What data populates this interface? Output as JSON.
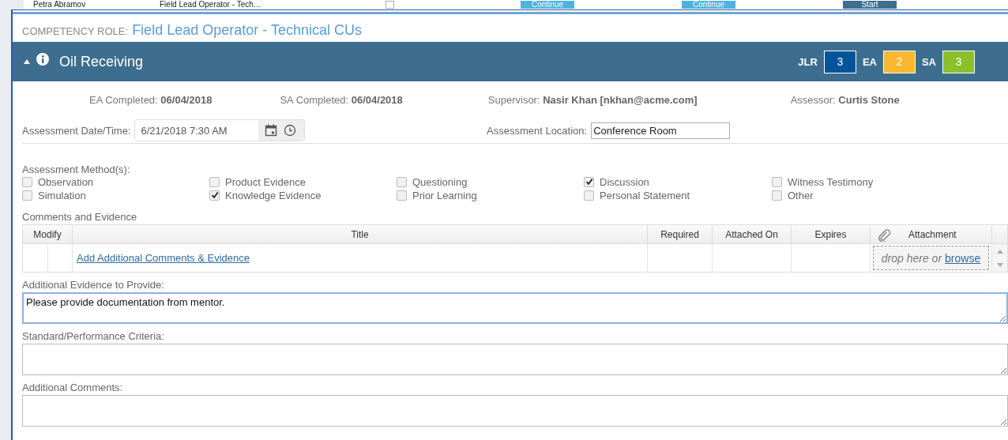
{
  "background_row": {
    "name": "Petra Abramov",
    "role": "Field Lead Operator - Tech…",
    "checked": false,
    "buttons": [
      "Continue",
      "Continue",
      "Start"
    ]
  },
  "competency_role": {
    "label": "COMPETENCY ROLE:",
    "value": "Field Lead Operator - Technical CUs"
  },
  "section": {
    "title": "Oil Receiving",
    "expanded": true,
    "scores": [
      {
        "label": "JLR",
        "value": "3",
        "color": "#02549a"
      },
      {
        "label": "EA",
        "value": "2",
        "color": "#fbb730"
      },
      {
        "label": "SA",
        "value": "3",
        "color": "#8bc02c"
      }
    ]
  },
  "info": [
    {
      "label": "EA Completed:",
      "value": "06/04/2018"
    },
    {
      "label": "SA Completed:",
      "value": "06/04/2018"
    },
    {
      "label": "Supervisor:",
      "value": "Nasir Khan [nkhan@acme.com]"
    },
    {
      "label": "Assessor:",
      "value": "Curtis Stone"
    }
  ],
  "assessment_datetime": {
    "label": "Assessment Date/Time:",
    "value": "6/21/2018 7:30 AM"
  },
  "assessment_location": {
    "label": "Assessment Location:",
    "value": "Conference Room"
  },
  "methods": {
    "label": "Assessment Method(s):",
    "options": [
      {
        "label": "Observation",
        "checked": false
      },
      {
        "label": "Product Evidence",
        "checked": false
      },
      {
        "label": "Questioning",
        "checked": false
      },
      {
        "label": "Discussion",
        "checked": true
      },
      {
        "label": "Witness Testimony",
        "checked": false
      },
      {
        "label": "Simulation",
        "checked": false
      },
      {
        "label": "Knowledge Evidence",
        "checked": true
      },
      {
        "label": "Prior Learning",
        "checked": false
      },
      {
        "label": "Personal Statement",
        "checked": false
      },
      {
        "label": "Other",
        "checked": false
      }
    ]
  },
  "comments_table": {
    "label": "Comments and Evidence",
    "columns": [
      "Modify",
      "Title",
      "Required",
      "Attached On",
      "Expires",
      "Attachment"
    ],
    "add_link": "Add Additional Comments & Evidence",
    "drop_text": "drop here or",
    "browse_link": "browse"
  },
  "text_areas": [
    {
      "label": "Additional Evidence to Provide:",
      "value": "Please provide documentation from mentor.",
      "focused": true
    },
    {
      "label": "Standard/Performance Criteria:",
      "focused": false
    },
    {
      "label": "Additional Comments:",
      "focused": false
    }
  ]
}
